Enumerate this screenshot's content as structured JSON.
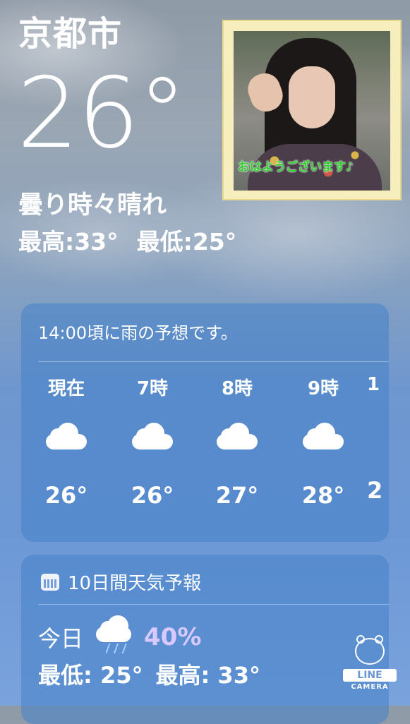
{
  "city": "京都市",
  "current_temp": "26°",
  "condition": "曇り時々晴れ",
  "high": "最高:33°",
  "low": "最低:25°",
  "photo": {
    "caption": "おはようございます♪"
  },
  "hourly": {
    "notice": "14:00頃に雨の予想です。",
    "hours": [
      {
        "label": "現在",
        "icon": "cloud-icon",
        "temp": "26°"
      },
      {
        "label": "7時",
        "icon": "cloud-icon",
        "temp": "26°"
      },
      {
        "label": "8時",
        "icon": "cloud-icon",
        "temp": "27°"
      },
      {
        "label": "9時",
        "icon": "cloud-icon",
        "temp": "28°"
      },
      {
        "label": "1",
        "icon": "cloud-icon",
        "temp": "2"
      }
    ]
  },
  "daily": {
    "title": "10日間天気予報",
    "today": {
      "label": "今日",
      "icon": "rain-cloud-icon",
      "precip": "40%",
      "low": "最低: 25°",
      "high": "最高: 33°"
    }
  },
  "badge": {
    "line": "LINE",
    "camera": "CAMERA"
  },
  "colors": {
    "precip": "#d9c9ff",
    "caption": "#2fd02c"
  }
}
